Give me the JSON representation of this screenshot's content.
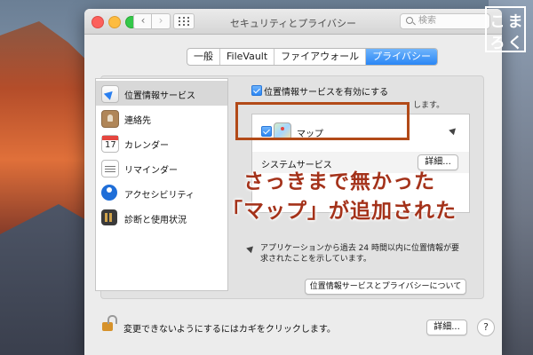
{
  "window": {
    "title": "セキュリティとプライバシー"
  },
  "search": {
    "placeholder": "検索"
  },
  "tabs": [
    {
      "label": "一般",
      "active": false
    },
    {
      "label": "FileVault",
      "active": false
    },
    {
      "label": "ファイアウォール",
      "active": false
    },
    {
      "label": "プライバシー",
      "active": true
    }
  ],
  "sidebar": {
    "items": [
      {
        "label": "位置情報サービス",
        "icon": "location-arrow-icon",
        "selected": true
      },
      {
        "label": "連絡先",
        "icon": "contacts-icon",
        "selected": false
      },
      {
        "label": "カレンダー",
        "icon": "calendar-icon",
        "selected": false,
        "icon_text": "17"
      },
      {
        "label": "リマインダー",
        "icon": "reminders-icon",
        "selected": false
      },
      {
        "label": "アクセシビリティ",
        "icon": "accessibility-icon",
        "selected": false
      },
      {
        "label": "診断と使用状況",
        "icon": "diagnostics-icon",
        "selected": false
      }
    ]
  },
  "pane": {
    "enable_label": "位置情報サービスを有効にする",
    "enable_checked": true,
    "cut_text": "します。",
    "apps": [
      {
        "label": "マップ",
        "checked": true,
        "icon": "maps-icon"
      }
    ],
    "system_services_label": "システムサービス",
    "details_button": "詳細...",
    "footnote": "アプリケーションから過去 24 時間以内に位置情報が要求されたことを示しています。",
    "about_button": "位置情報サービスとプライバシーについて"
  },
  "bottom": {
    "lock_text": "変更できないようにするにはカギをクリックします。",
    "advanced_button": "詳細...",
    "help_button": "?"
  },
  "annotation": {
    "line1": "さっきまで無かった",
    "line2": "「マップ」が追加された"
  },
  "logo": {
    "chars": [
      "こ",
      "ま",
      "ろ",
      "く"
    ]
  },
  "colors": {
    "accent": "#2a86f5",
    "annotation_red": "#a4321a",
    "highlight_border": "#b24a18"
  }
}
